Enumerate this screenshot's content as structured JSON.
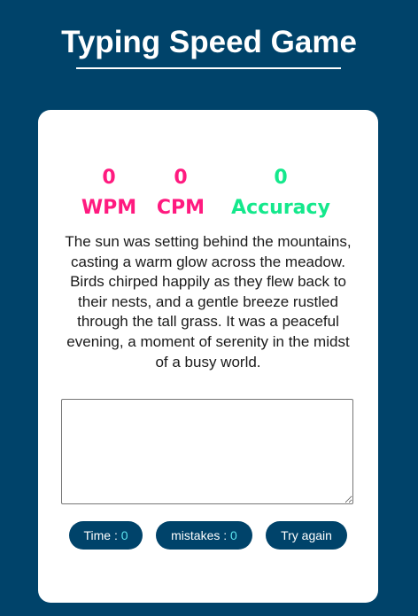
{
  "header": {
    "title": "Typing Speed Game"
  },
  "stats": {
    "wpm": {
      "value": "0",
      "label": "WPM"
    },
    "cpm": {
      "value": "0",
      "label": "CPM"
    },
    "accuracy": {
      "value": "0",
      "label": "Accuracy"
    }
  },
  "passage": {
    "text": "The sun was setting behind the mountains, casting a warm glow across the meadow. Birds chirped happily as they flew back to their nests, and a gentle breeze rustled through the tall grass. It was a peaceful evening, a moment of serenity in the midst of a busy world."
  },
  "input": {
    "value": "",
    "placeholder": ""
  },
  "footer": {
    "time_label": "Time : ",
    "time_value": "0",
    "mistakes_label": "mistakes : ",
    "mistakes_value": "0",
    "retry_label": "Try again"
  },
  "colors": {
    "background": "#00436a",
    "card": "#ffffff",
    "wpm_cpm": "#ff1a7f",
    "accuracy": "#14e88c",
    "pill_value": "#5ce5f0"
  }
}
